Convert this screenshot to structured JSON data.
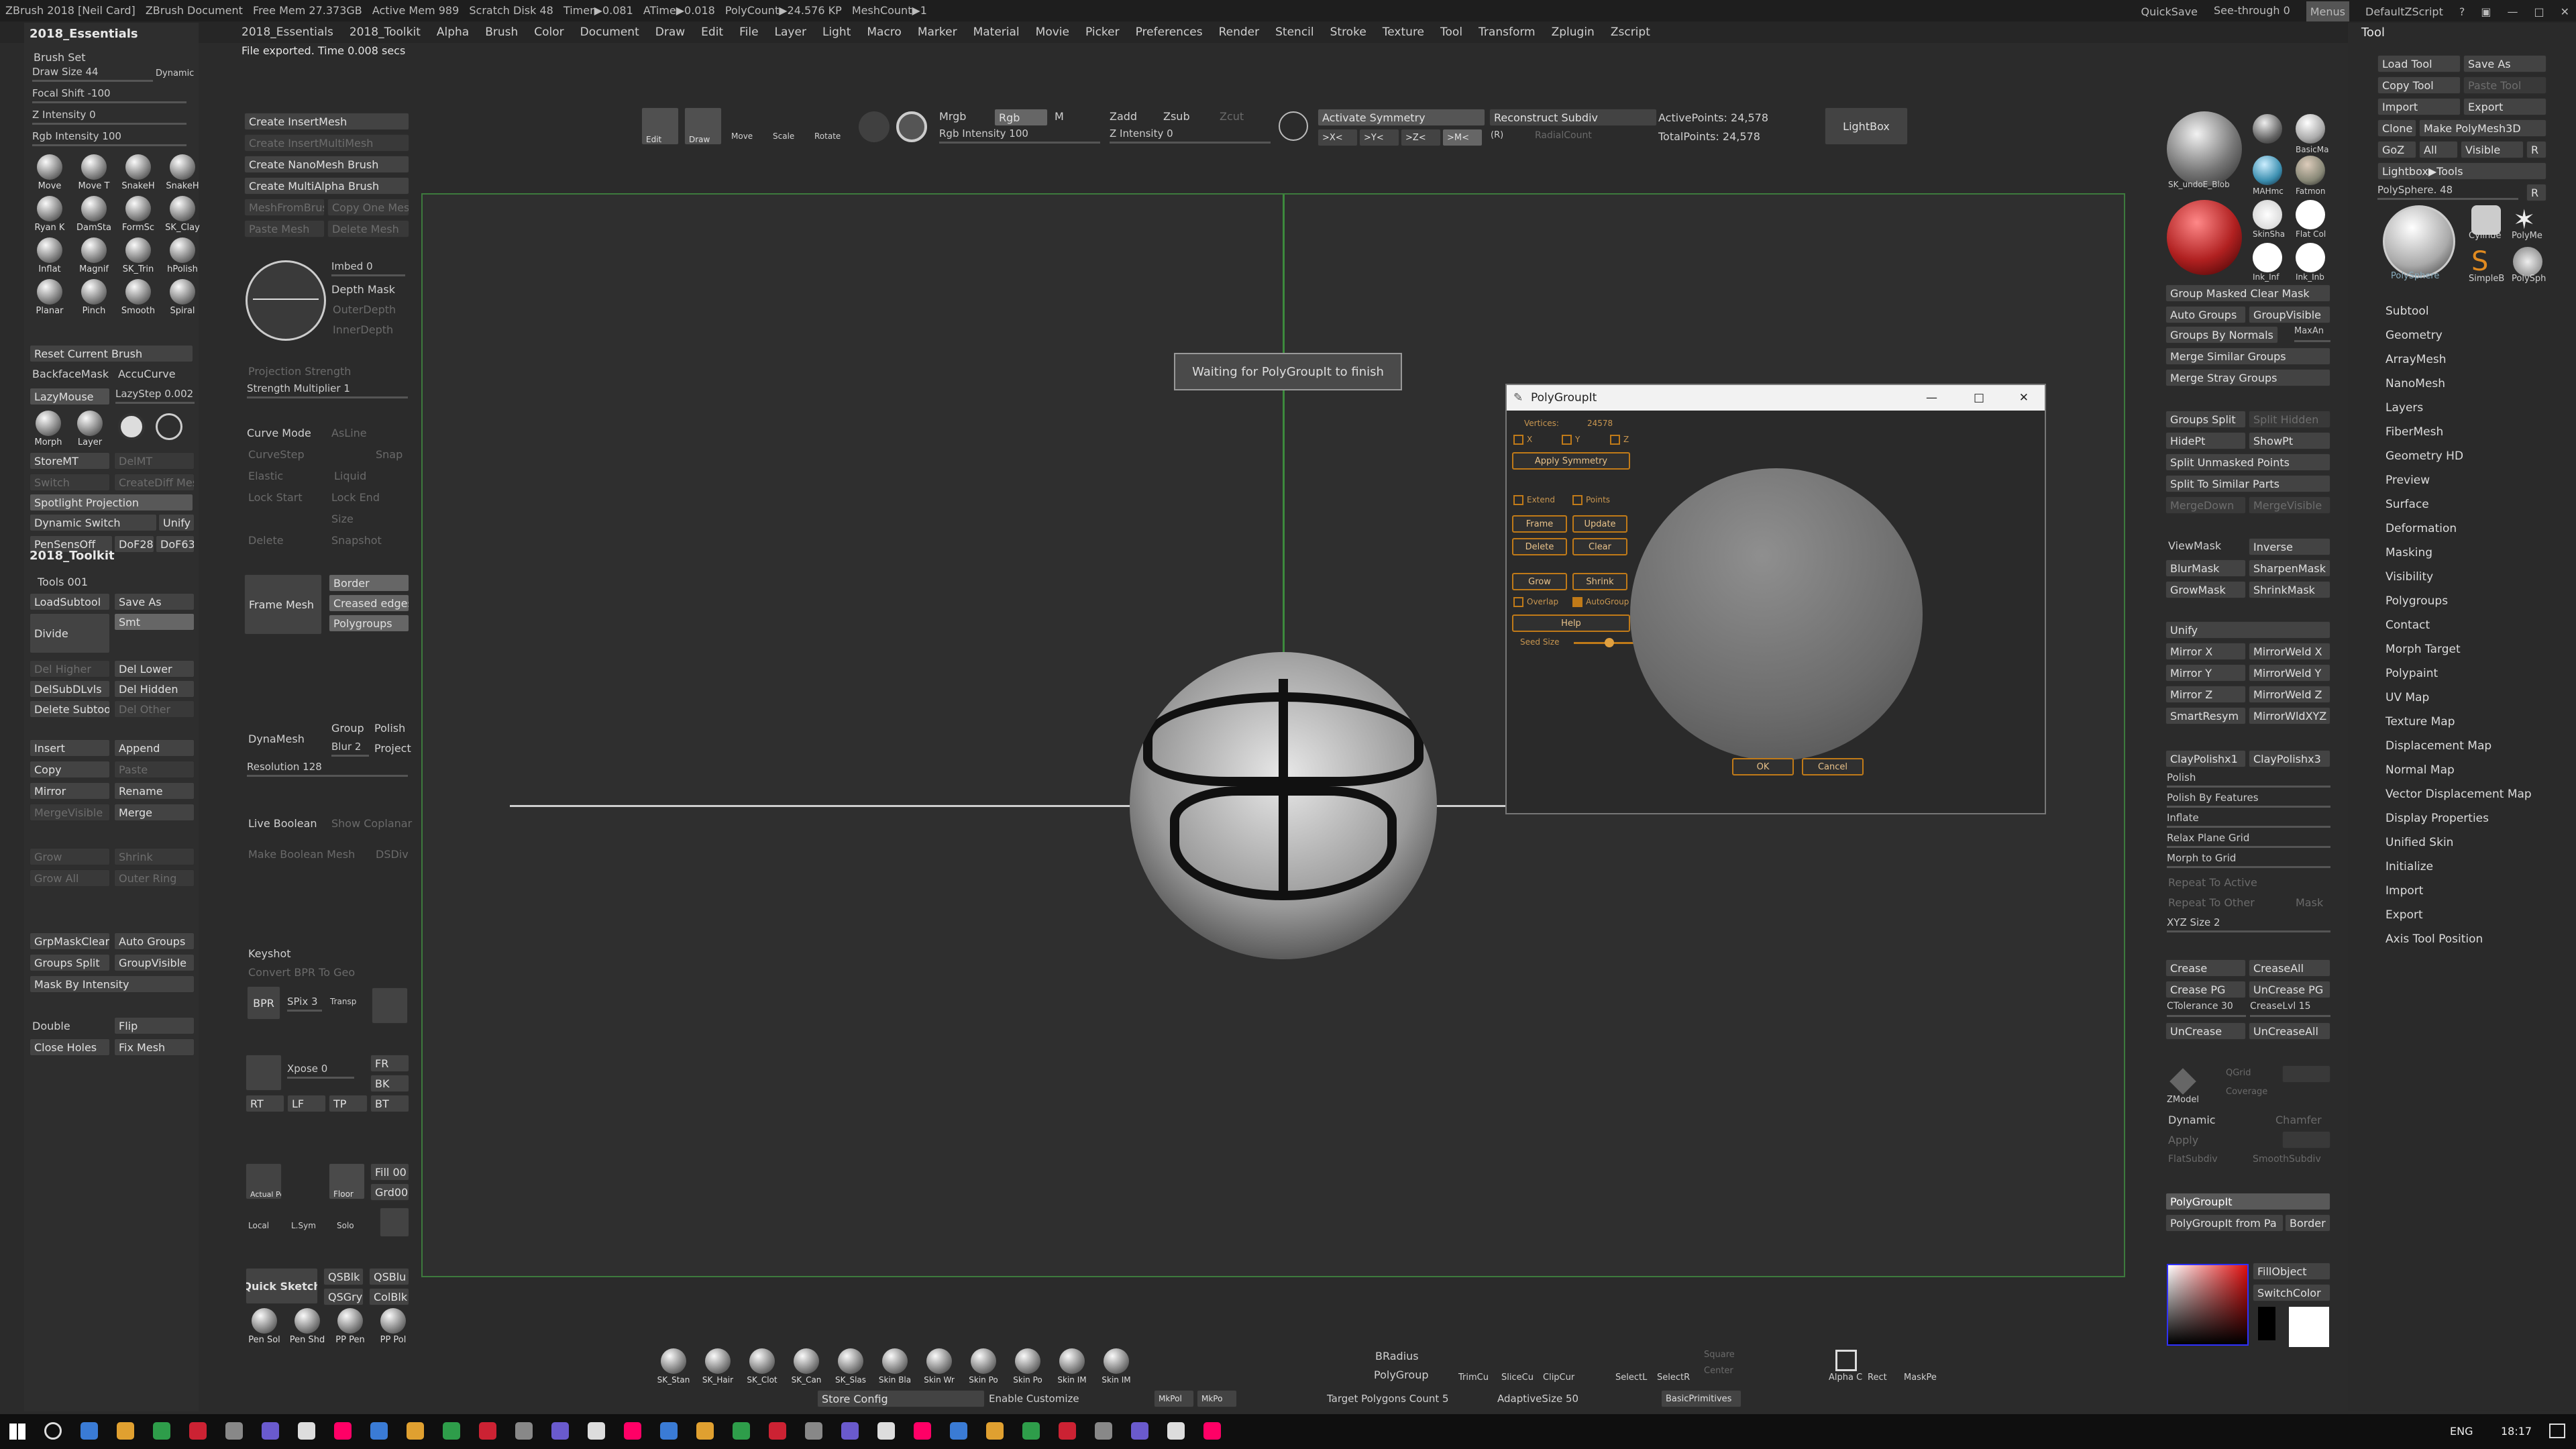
{
  "titlebar": {
    "items": [
      "ZBrush 2018 [Neil Card]",
      "ZBrush Document",
      "Free Mem 27.373GB",
      "Active Mem 989",
      "Scratch Disk 48",
      "Timer▶0.081",
      "ATime▶0.018",
      "PolyCount▶24.576 KP",
      "MeshCount▶1"
    ],
    "quicksave": "QuickSave",
    "seethrough": "See-through  0",
    "menus": "Menus",
    "defaultzscript": "DefaultZScript"
  },
  "menubar": [
    "2018_Essentials",
    "2018_Toolkit",
    "Alpha",
    "Brush",
    "Color",
    "Document",
    "Draw",
    "Edit",
    "File",
    "Layer",
    "Light",
    "Macro",
    "Marker",
    "Material",
    "Movie",
    "Picker",
    "Preferences",
    "Render",
    "Stencil",
    "Stroke",
    "Texture",
    "Tool",
    "Transform",
    "Zplugin",
    "Zscript"
  ],
  "status": "File exported. Time 0.008 secs",
  "left": {
    "title": "2018_Essentials",
    "brushset": "Brush Set",
    "drawsize": "Draw Size 44",
    "dynamic": "Dynamic",
    "focalshift": "Focal Shift -100",
    "zintensity": "Z Intensity 0",
    "rgbintensity": "Rgb Intensity 100",
    "brushes": [
      "Move",
      "Move T",
      "SnakeH",
      "SnakeH",
      "Ryan K",
      "DamSta",
      "FormSc",
      "SK_Clay",
      "Inflat",
      "Magnif",
      "SK_Trin",
      "hPolish",
      "Planar",
      "Pinch",
      "Smooth",
      "Spiral"
    ],
    "reset": "Reset Current Brush",
    "backface": "BackfaceMask",
    "accucurve": "AccuCurve",
    "lazymouse": "LazyMouse",
    "lazystep": "LazyStep 0.002",
    "morph": "Morph",
    "layer": "Layer",
    "storemt": "StoreMT",
    "delmt": "DelMT",
    "switch": "Switch",
    "creatediffmesh": "CreateDiff Mesh",
    "spotlight": "Spotlight Projection",
    "dynsolo": "Dynamic Switch",
    "unify": "Unify",
    "pensens": "PenSensOff",
    "dof28": "DoF28",
    "dof63": "DoF63",
    "toolkit": "2018_Toolkit",
    "tools001": "Tools 001",
    "loadsubtool": "LoadSubtool",
    "saveas": "Save As",
    "divide": "Divide",
    "smt": "Smt",
    "delhigher": "Del Higher",
    "dellower": "Del Lower",
    "delsubdlvls": "DelSubDLvls",
    "delhidden": "Del Hidden",
    "deletesubtool": "Delete Subtool",
    "delother": "Del Other",
    "insert": "Insert",
    "append": "Append",
    "copy": "Copy",
    "paste": "Paste",
    "mirror": "Mirror",
    "rename": "Rename",
    "mergevisible": "MergeVisible",
    "merge": "Merge",
    "grow": "Grow",
    "shrink": "Shrink",
    "growall": "Grow All",
    "outerring": "Outer Ring",
    "grpmaskclear": "GrpMaskClear",
    "autogroups": "Auto Groups",
    "groupssplit": "Groups Split",
    "groupvisible": "GroupVisible",
    "maskbyint": "Mask By Intensity",
    "double": "Double",
    "flip": "Flip",
    "closeholes": "Close Holes",
    "fixmesh": "Fix Mesh"
  },
  "left2": {
    "createinsert": "Create InsertMesh",
    "createinsertmulti": "Create InsertMultiMesh",
    "createnano": "Create NanoMesh Brush",
    "createmultialpha": "Create MultiAlpha Brush",
    "meshfrombrush": "MeshFromBrush",
    "copyonemesh": "Copy One Mesh",
    "pasteone": "Paste Mesh",
    "deletemesh": "Delete Mesh",
    "imbed": "Imbed 0",
    "depthmask": "Depth Mask",
    "outerdepth": "OuterDepth",
    "innerdepth": "InnerDepth",
    "projstrength": "Projection Strength",
    "strengthmult": "Strength Multiplier 1",
    "curvemode": "Curve Mode",
    "asline": "AsLine",
    "curvestep": "CurveStep",
    "snap": "Snap",
    "elastic": "Elastic",
    "liquid": "Liquid",
    "lockstart": "Lock Start",
    "lockend": "Lock End",
    "size": "Size",
    "delete": "Delete",
    "snapshot": "Snapshot",
    "framemesh": "Frame Mesh",
    "border": "Border",
    "creasededges": "Creased edges",
    "polygroups": "Polygroups",
    "dynamesh": "DynaMesh",
    "group": "Group",
    "polish": "Polish",
    "blur": "Blur 2",
    "project": "Project",
    "resolution": "Resolution 128",
    "liveboolean": "Live Boolean",
    "showcoplanar": "Show Coplanar",
    "makeboolean": "Make Boolean Mesh",
    "dsdiv": "DSDiv",
    "keyshot": "Keyshot",
    "convertbpr": "Convert BPR To Geo",
    "bpr": "BPR",
    "spix": "SPix 3",
    "transp": "Transp",
    "xpose": "Xpose 0",
    "fr": "FR",
    "bk": "BK",
    "rt": "RT",
    "lf": "LF",
    "tp": "TP",
    "bt": "BT",
    "actualpersp": "Actual Persp",
    "floor": "Floor",
    "fill00": "Fill 00",
    "grd00": "Grd00",
    "local": "Local",
    "lsym": "L.Sym",
    "solo": "Solo",
    "quicksketch": "Quick Sketch",
    "qsblk": "QSBlk",
    "qsblu": "QSBlu",
    "qsgry": "QSGry",
    "colblk": "ColBlk",
    "brushes2": [
      "Pen Sol",
      "Pen Shd",
      "PP Pen",
      "PP Pol"
    ]
  },
  "toolbar": {
    "edit": "Edit",
    "draw": "Draw",
    "move": "Move",
    "scale": "Scale",
    "rotate": "Rotate",
    "mrgb": "Mrgb",
    "rgb": "Rgb",
    "m": "M",
    "rgbint": "Rgb Intensity 100",
    "zadd": "Zadd",
    "zsub": "Zsub",
    "zcut": "Zcut",
    "zint": "Z Intensity 0",
    "activesym": "Activate Symmetry",
    "reconstruct": "Reconstruct Subdiv",
    "activepoints": "ActivePoints: 24,578",
    "totalpoints": "TotalPoints: 24,578",
    "lightbox": "LightBox",
    "x": ">X<",
    "y": ">Y<",
    "z": ">Z<",
    "m2": ">M<",
    "r": "(R)",
    "radialcount": "RadialCount"
  },
  "waiting": "Waiting for PolyGroupIt to finish",
  "dialog": {
    "title": "PolyGroupIt",
    "vertices_label": "Vertices:",
    "vertices": "24578",
    "x": "X",
    "y": "Y",
    "z": "Z",
    "applysym": "Apply Symmetry",
    "extend": "Extend",
    "points": "Points",
    "frame": "Frame",
    "update": "Update",
    "delete": "Delete",
    "clear": "Clear",
    "grow": "Grow",
    "shrink": "Shrink",
    "overlap": "Overlap",
    "autogroup": "AutoGroup",
    "help": "Help",
    "seedsize": "Seed Size",
    "ok": "OK",
    "cancel": "Cancel"
  },
  "right": {
    "skin": "SK_undoE_Blob",
    "basicm": "BasicMa",
    "mahmc": "MAHmc",
    "fatmon": "Fatmon",
    "skinshade": "SkinSha",
    "flatcol": "Flat Col",
    "inkinf": "Ink_Inf",
    "inkinb": "Ink_Inb",
    "groupmaskedclear": "Group Masked Clear Mask",
    "autogroups": "Auto Groups",
    "groupvisible": "GroupVisible",
    "groupsbynormals": "Groups By Normals",
    "maxan": "MaxAn",
    "mergesimilar": "Merge Similar Groups",
    "mergestray": "Merge Stray Groups",
    "groupssplit": "Groups Split",
    "splithidden": "Split Hidden",
    "hidept": "HidePt",
    "showpt": "ShowPt",
    "splitunmasked": "Split Unmasked Points",
    "splitsimilar": "Split To Similar Parts",
    "mergedown": "MergeDown",
    "mergevisible": "MergeVisible",
    "viewmask": "ViewMask",
    "inverse": "Inverse",
    "blurmask": "BlurMask",
    "sharpenmask": "SharpenMask",
    "growmask": "GrowMask",
    "shrinkmask": "ShrinkMask",
    "unify": "Unify",
    "mirrorx": "Mirror X",
    "mirrorweldx": "MirrorWeld X",
    "mirrory": "Mirror Y",
    "mirrorweldy": "MirrorWeld Y",
    "mirrorz": "Mirror Z",
    "mirrorweldz": "MirrorWeld Z",
    "smartresym": "SmartResym",
    "mirrorweldxyz": "MirrorWldXYZ",
    "claypolish1": "ClayPolishx1",
    "claypolish3": "ClayPolishx3",
    "polish": "Polish",
    "polishbyfeatures": "Polish By Features",
    "inflate": "Inflate",
    "relaxplane": "Relax Plane Grid",
    "morphtogrid": "Morph to Grid",
    "repeatactive": "Repeat To Active",
    "repeatother": "Repeat To Other",
    "mask": "Mask",
    "xyzsize": "XYZ Size 2",
    "crease": "Crease",
    "creaseall": "CreaseAll",
    "creasepg": "Crease PG",
    "uncreasepg": "UnCrease PG",
    "ctolerance": "CTolerance 30",
    "creaselvl": "CreaseLvl 15",
    "uncrease": "UnCrease",
    "uncreaseall": "UnCreaseAll",
    "zmodel": "ZModel",
    "qgrid": "QGrid",
    "coverage": "Coverage",
    "dynamic": "Dynamic",
    "chamfer": "Chamfer",
    "apply": "Apply",
    "flatsubdiv": "FlatSubdiv",
    "smoothsubdiv": "SmoothSubdiv",
    "polygroupit": "PolyGroupIt",
    "polygroupitfrompaint": "PolyGroupIt from Pa",
    "border": "Border",
    "fillobject": "FillObject",
    "switchcolor": "SwitchColor"
  },
  "tool": {
    "title": "Tool",
    "loadtool": "Load Tool",
    "saveas": "Save As",
    "copytool": "Copy Tool",
    "pastetool": "Paste Tool",
    "import": "Import",
    "export": "Export",
    "clone": "Clone",
    "makepolymesh": "Make PolyMesh3D",
    "goz": "GoZ",
    "all": "All",
    "visible": "Visible",
    "r": "R",
    "lightboxtools": "Lightbox▶Tools",
    "polysphere": "PolySphere. 48",
    "tools": [
      "PolySphere",
      "Cylinde",
      "PolyMe",
      "SimpleB",
      "PolySph"
    ],
    "menu": [
      "Subtool",
      "Geometry",
      "ArrayMesh",
      "NanoMesh",
      "Layers",
      "FiberMesh",
      "Geometry HD",
      "Preview",
      "Surface",
      "Deformation",
      "Masking",
      "Visibility",
      "Polygroups",
      "Contact",
      "Morph Target",
      "Polypaint",
      "UV Map",
      "Texture Map",
      "Displacement Map",
      "Normal Map",
      "Vector Displacement Map",
      "Display Properties",
      "Unified Skin",
      "Initialize",
      "Import",
      "Export",
      "Axis Tool Position"
    ]
  },
  "shelf": {
    "brushes": [
      "SK_Stan",
      "SK_Hair",
      "SK_Clot",
      "SK_Can",
      "SK_Slas",
      "Skin Bla",
      "Skin Wr",
      "Skin Po",
      "Skin Po",
      "Skin IM",
      "Skin IM"
    ],
    "bradius": "BRadius",
    "polygroup": "PolyGroup",
    "trimcu": "TrimCu",
    "slicecu": "SliceCu",
    "clipcur": "ClipCur",
    "selectl": "SelectL",
    "selectr": "SelectR",
    "square": "Square",
    "center": "Center",
    "alphac": "Alpha C",
    "rect": "Rect",
    "maskpe": "MaskPe",
    "storeconfig": "Store Config",
    "enablecustomize": "Enable Customize",
    "targetpoly": "Target Polygons Count 5",
    "adaptivesize": "AdaptiveSize 50",
    "basicprimitives": "BasicPrimitives",
    "mkpolv": "MkPol",
    "mkpo2": "MkPo"
  },
  "taskbar": {
    "lang": "ENG",
    "time": "18:17"
  },
  "colors": {
    "bg": "#2b2b2b",
    "orange": "#c07a18",
    "green": "#3d7a3d",
    "red": "#c02020"
  }
}
